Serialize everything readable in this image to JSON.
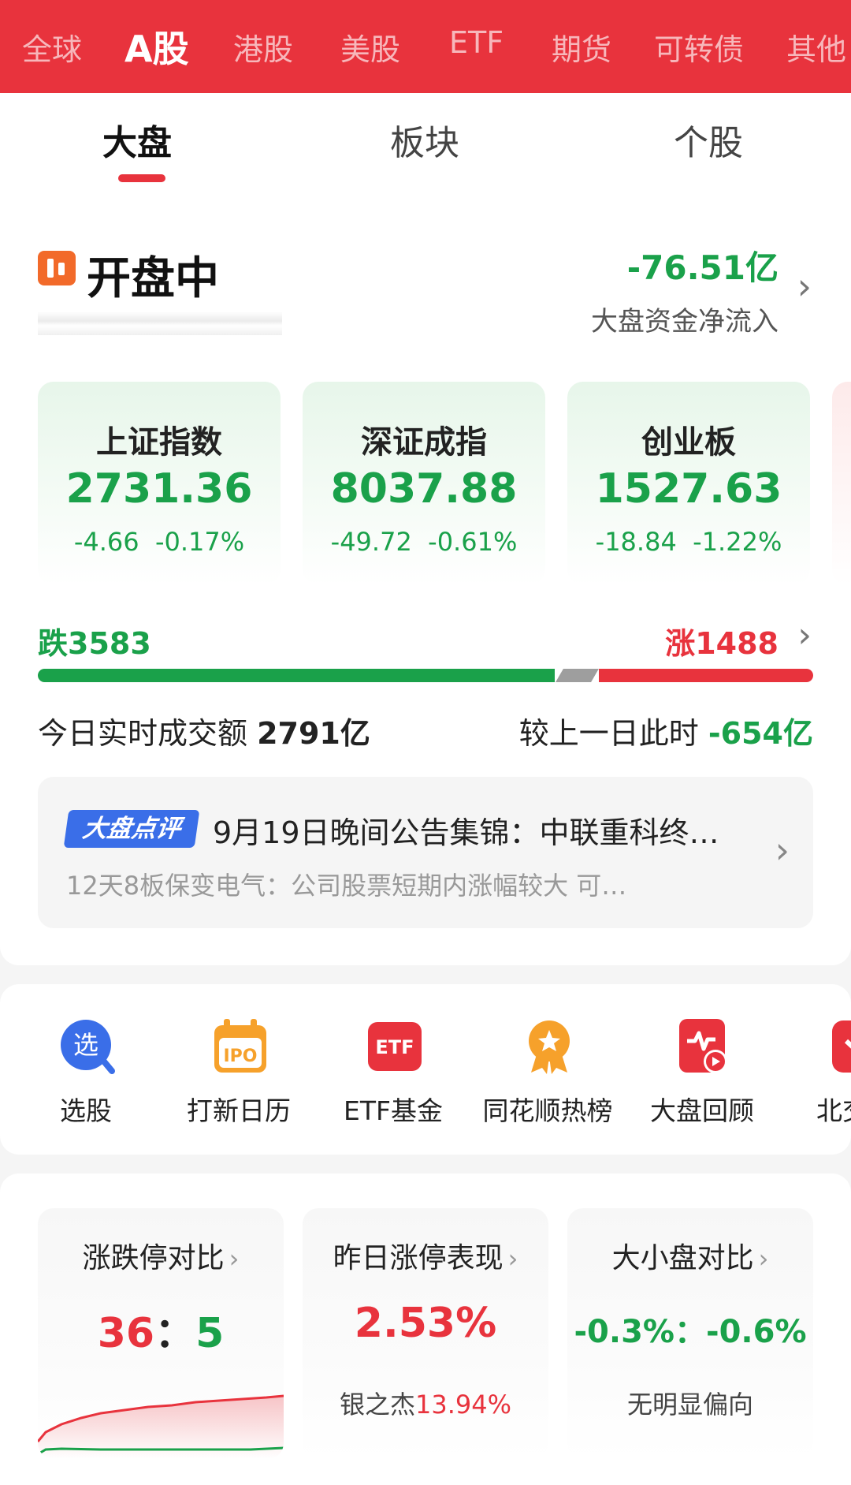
{
  "market_tabs": [
    "全球",
    "A股",
    "港股",
    "美股",
    "ETF",
    "期货",
    "可转债",
    "其他"
  ],
  "sub_tabs": [
    "大盘",
    "板块",
    "个股"
  ],
  "status": {
    "title": "开盘中"
  },
  "fund_flow": {
    "value": "-76.51亿",
    "label": "大盘资金净流入"
  },
  "indices": [
    {
      "name": "上证指数",
      "price": "2731.36",
      "change": "-4.66  -0.17%"
    },
    {
      "name": "深证成指",
      "price": "8037.88",
      "change": "-49.72  -0.61%"
    },
    {
      "name": "创业板",
      "price": "1527.63",
      "change": "-18.84  -1.22%"
    }
  ],
  "breadth": {
    "fall_label": "跌3583",
    "rise_label": "涨1488",
    "fall": 3583,
    "rise": 1488,
    "flat_fraction": 0.05
  },
  "turnover": {
    "label": "今日实时成交额",
    "value": "2791亿",
    "compare_label": "较上一日此时",
    "compare_value": "-654亿"
  },
  "news": {
    "badge": "大盘点评",
    "title": "9月19日晚间公告集锦：中联重科终…",
    "summary": "12天8板保变电气：公司股票短期内涨幅较大 可…"
  },
  "quick_menu": [
    "选股",
    "打新日历",
    "ETF基金",
    "同花顺热榜",
    "大盘回顾",
    "北交"
  ],
  "stats": [
    {
      "title": "涨跌停对比",
      "up": "36",
      "sep": "：",
      "down": "5"
    },
    {
      "title": "昨日涨停表现",
      "value": "2.53%",
      "stock": "银之杰",
      "stock_value": "13.94%"
    },
    {
      "title": "大小盘对比",
      "value": "-0.3%：-0.6%",
      "note": "无明显偏向"
    }
  ],
  "colors": {
    "up": "#e8333d",
    "down": "#1aa14a",
    "accent": "#e8333d",
    "badge": "#3a6ee8"
  }
}
